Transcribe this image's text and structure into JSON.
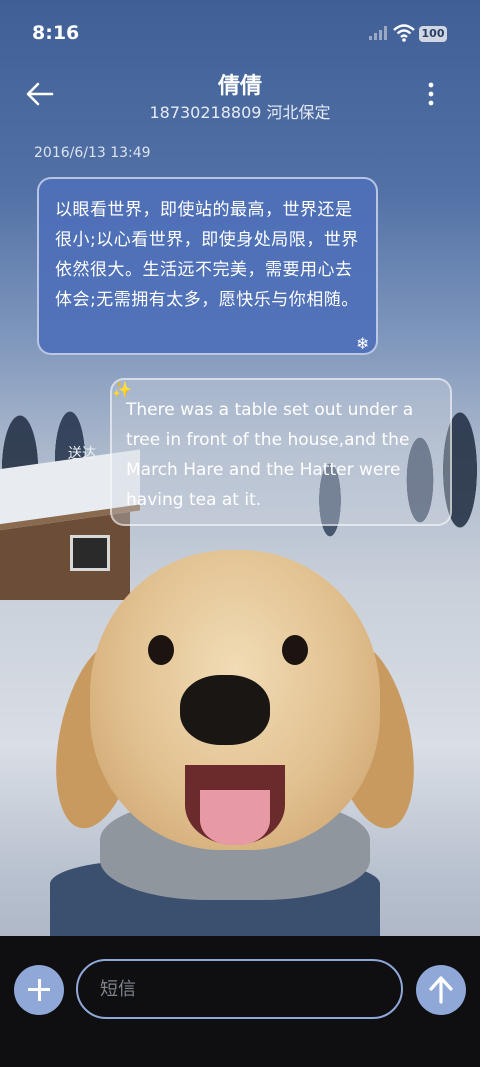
{
  "status_bar": {
    "time": "8:16",
    "battery": "100",
    "icons": [
      "signal-icon",
      "wifi-icon",
      "battery-icon"
    ]
  },
  "header": {
    "contact_name": "倩倩",
    "contact_detail": "18730218809 河北保定",
    "back_icon": "back-arrow-icon",
    "more_icon": "more-vertical-icon"
  },
  "conversation": {
    "timestamp": "2016/6/13 13:49",
    "messages": [
      {
        "text": "以眼看世界，即使站的最高，世界还是很小;以心看世界，即使身处局限，世界依然很大。生活远不完美，需要用心去体会;无需拥有太多，愿快乐与你相随。",
        "badge_icon": "snowflake-icon"
      },
      {
        "text": "There was a table set out under a tree in front of the house,and the March Hare and the Hatter were having tea at it.",
        "badge_icon": "sparkle-icon",
        "status": "送达"
      }
    ]
  },
  "composer": {
    "placeholder": "短信",
    "add_icon": "plus-icon",
    "send_icon": "send-arrow-icon"
  },
  "colors": {
    "accent": "#8fa8d8",
    "bubble_sent_blue": "#4e70b9",
    "bottom_bar": "#0f0f11"
  }
}
